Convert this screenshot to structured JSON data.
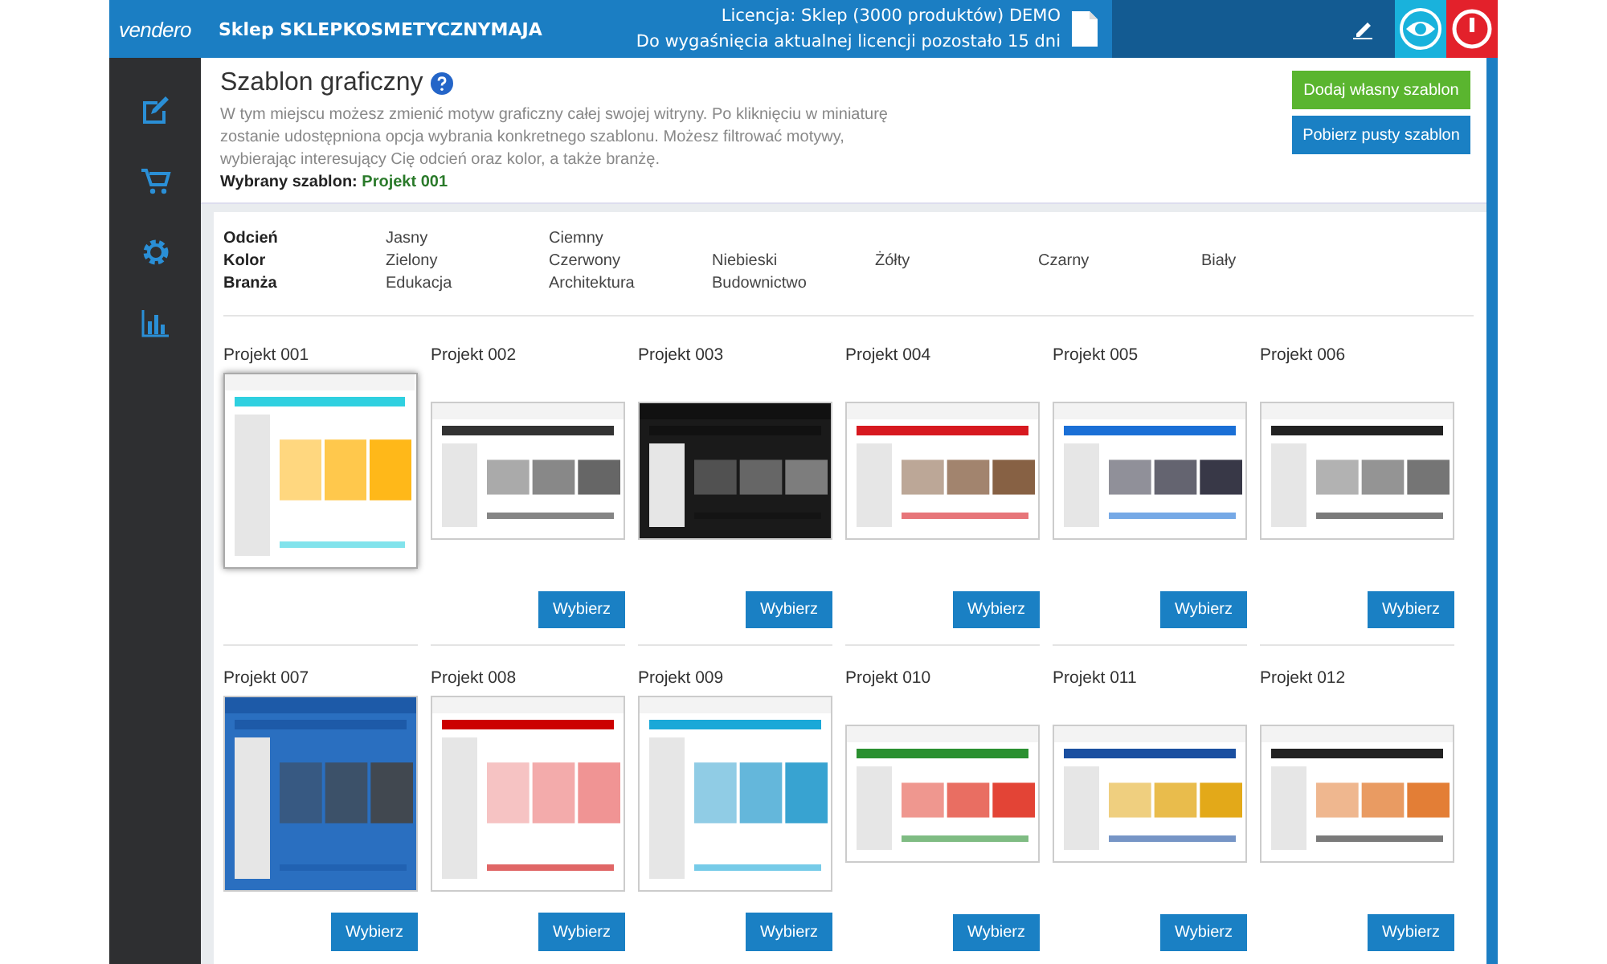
{
  "header": {
    "logo": "vendero",
    "shop": "Sklep SKLEPKOSMETYCZNYMAJA",
    "license": [
      "Licencja: Sklep (3000 produktów) DEMO",
      "Do wygaśnięcia aktualnej licencji pozostało 15 dni"
    ]
  },
  "intro": {
    "title": "Szablon graficzny",
    "description": "W tym miejscu możesz zmienić motyw graficzny całej swojej witryny. Po kliknięciu w miniaturę zostanie udostępniona opcja wybrania konkretnego szablonu. Możesz filtrować motywy, wybierając interesujący Cię odcień oraz kolor, a także branżę.",
    "selected_label": "Wybrany szablon:",
    "selected_value": "Projekt 001",
    "buttons": [
      {
        "label": "Dodaj własny szablon",
        "kind": "primary"
      },
      {
        "label": "Pobierz pusty szablon",
        "kind": "secondary"
      }
    ]
  },
  "filters": [
    {
      "label": "Odcień",
      "options": [
        "Jasny",
        "Ciemny"
      ]
    },
    {
      "label": "Kolor",
      "options": [
        "Zielony",
        "Czerwony",
        "Niebieski",
        "Żółty",
        "Czarny",
        "Biały"
      ]
    },
    {
      "label": "Branża",
      "options": [
        "Edukacja",
        "Architektura",
        "Budownictwo"
      ]
    }
  ],
  "templates": [
    {
      "name": "Projekt 001",
      "selected": true
    },
    {
      "name": "Projekt 002",
      "selected": false,
      "button": "Wybierz"
    },
    {
      "name": "Projekt 003",
      "selected": false,
      "button": "Wybierz"
    },
    {
      "name": "Projekt 004",
      "selected": false,
      "button": "Wybierz"
    },
    {
      "name": "Projekt 005",
      "selected": false,
      "button": "Wybierz"
    },
    {
      "name": "Projekt 006",
      "selected": false,
      "button": "Wybierz"
    },
    {
      "name": "Projekt 007",
      "selected": false,
      "button": "Wybierz"
    },
    {
      "name": "Projekt 008",
      "selected": false,
      "button": "Wybierz"
    },
    {
      "name": "Projekt 009",
      "selected": false,
      "button": "Wybierz"
    },
    {
      "name": "Projekt 010",
      "selected": false,
      "button": "Wybierz"
    },
    {
      "name": "Projekt 011",
      "selected": false,
      "button": "Wybierz"
    },
    {
      "name": "Projekt 012",
      "selected": false,
      "button": "Wybierz"
    }
  ]
}
